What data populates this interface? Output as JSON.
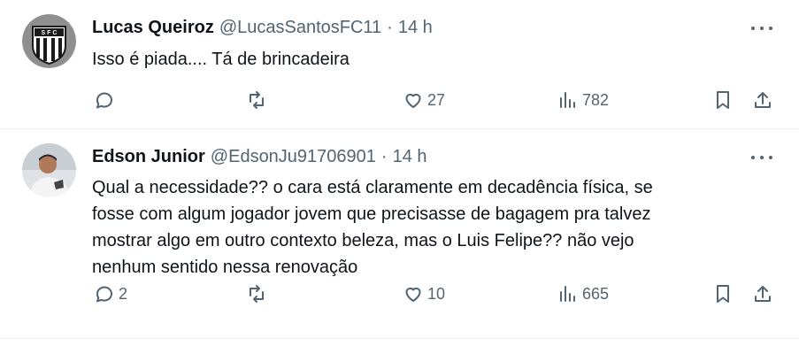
{
  "tweets": [
    {
      "name": "Lucas Queiroz",
      "handle": "@LucasSantosFC11",
      "dot": "·",
      "time": "14 h",
      "text": "Isso é piada.... Tá de brincadeira",
      "replies": "",
      "retweets": "",
      "likes": "27",
      "views": "782",
      "avatar_icon": "santos-crest-icon"
    },
    {
      "name": "Edson Junior",
      "handle": "@EdsonJu91706901",
      "dot": "·",
      "time": "14 h",
      "text": "Qual a necessidade?? o cara está claramente em decadência física, se\nfosse com algum jogador jovem que precisasse de bagagem pra talvez\nmostrar algo em outro contexto beleza, mas o Luis Felipe?? não vejo\nnenhum sentido nessa renovação",
      "replies": "2",
      "retweets": "",
      "likes": "10",
      "views": "665",
      "avatar_icon": "person-photo-icon"
    }
  ],
  "colors": {
    "text": "#0f1419",
    "muted": "#536471",
    "divider": "#eff3f4"
  }
}
